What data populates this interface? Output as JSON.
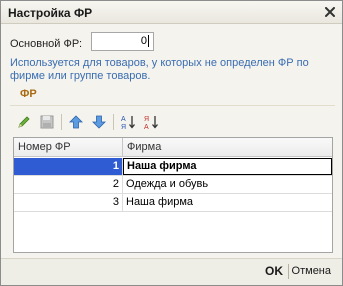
{
  "window": {
    "title": "Настройка ФР"
  },
  "form": {
    "label": "Основной ФР:",
    "value": "0",
    "hint": "Используется для товаров, у которых не определен ФР по фирме или группе товаров."
  },
  "section": {
    "title": "ФР"
  },
  "toolbar": {
    "items": [
      {
        "icon": "pencil-edit-icon"
      },
      {
        "icon": "save-disabled-icon"
      },
      {
        "icon": "arrow-up-icon"
      },
      {
        "icon": "arrow-down-icon"
      },
      {
        "icon": "sort-ascending-icon"
      },
      {
        "icon": "sort-descending-icon"
      }
    ]
  },
  "table": {
    "columns": [
      "Номер ФР",
      "Фирма"
    ],
    "rows": [
      {
        "num": "1",
        "firm": "Наша фирма",
        "selected": true
      },
      {
        "num": "2",
        "firm": "Одежда и обувь",
        "selected": false
      },
      {
        "num": "3",
        "firm": "Наша фирма",
        "selected": false
      }
    ]
  },
  "footer": {
    "ok": "OK",
    "cancel": "Отмена"
  },
  "colors": {
    "selection": "#2f5bd3",
    "hint": "#3a6db1",
    "section": "#a86b12"
  }
}
